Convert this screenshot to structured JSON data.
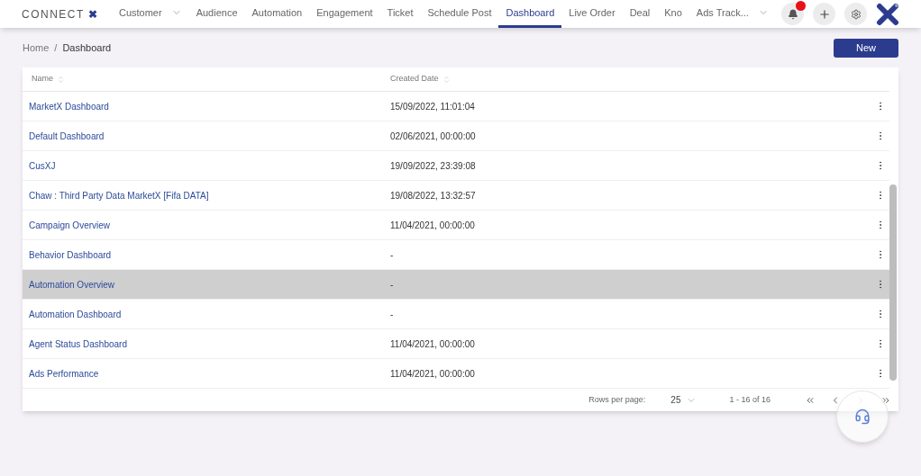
{
  "brand": {
    "text": "CONNECT",
    "mark": "✖"
  },
  "nav": [
    {
      "label": "Customer",
      "selected": false,
      "dropdown": true
    },
    {
      "label": "Audience",
      "selected": false,
      "dropdown": false
    },
    {
      "label": "Automation",
      "selected": false,
      "dropdown": false
    },
    {
      "label": "Engagement",
      "selected": false,
      "dropdown": false
    },
    {
      "label": "Ticket",
      "selected": false,
      "dropdown": false
    },
    {
      "label": "Schedule Post",
      "selected": false,
      "dropdown": false
    },
    {
      "label": "Dashboard",
      "selected": true,
      "dropdown": false
    },
    {
      "label": "Live Order",
      "selected": false,
      "dropdown": false
    },
    {
      "label": "Deal",
      "selected": false,
      "dropdown": false
    },
    {
      "label": "Kno",
      "selected": false,
      "dropdown": false
    },
    {
      "label": "Ads Track...",
      "selected": false,
      "dropdown": true
    }
  ],
  "notification_badge": true,
  "breadcrumb": [
    "Home",
    "/",
    "Dashboard"
  ],
  "new_button": "New",
  "table": {
    "columns": [
      "Name",
      "Created Date"
    ],
    "rows": [
      {
        "name": "MarketX Dashboard",
        "created": "15/09/2022, 11:01:04",
        "selected": false
      },
      {
        "name": "Default Dashboard",
        "created": "02/06/2021, 00:00:00",
        "selected": false
      },
      {
        "name": "CusXJ",
        "created": "19/09/2022, 23:39:08",
        "selected": false
      },
      {
        "name": "Chaw : Third Party Data MarketX [Fifa DATA]",
        "created": "19/08/2022, 13:32:57",
        "selected": false
      },
      {
        "name": "Campaign Overview",
        "created": "11/04/2021, 00:00:00",
        "selected": false
      },
      {
        "name": "Behavior Dashboard",
        "created": "-",
        "selected": false
      },
      {
        "name": "Automation Overview",
        "created": "-",
        "selected": true
      },
      {
        "name": "Automation Dashboard",
        "created": "-",
        "selected": false
      },
      {
        "name": "Agent Status Dashboard",
        "created": "11/04/2021, 00:00:00",
        "selected": false
      },
      {
        "name": "Ads Performance",
        "created": "11/04/2021, 00:00:00",
        "selected": false
      }
    ]
  },
  "pagination": {
    "rows_per_page_label": "Rows per page:",
    "rows_per_page": "25",
    "range": "1 - 16 of 16"
  }
}
